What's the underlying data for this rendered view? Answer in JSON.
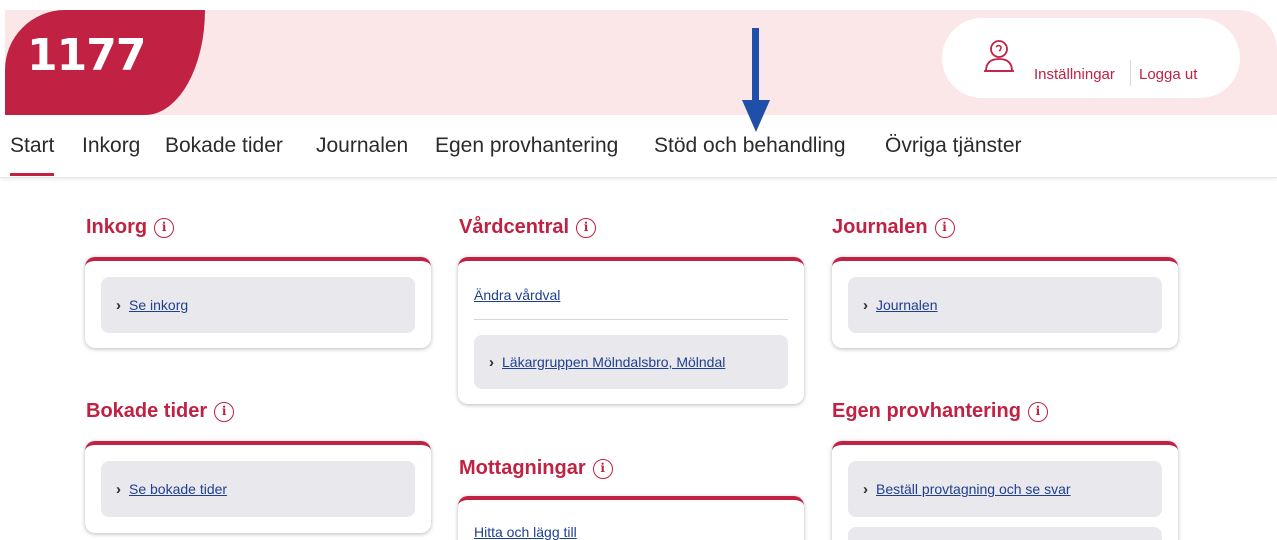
{
  "header": {
    "logo": "1177",
    "settings_label": "Inställningar",
    "logout_label": "Logga ut"
  },
  "nav": {
    "items": [
      "Start",
      "Inkorg",
      "Bokade tider",
      "Journalen",
      "Egen provhantering",
      "Stöd och behandling",
      "Övriga tjänster"
    ],
    "active": "Start"
  },
  "sections": {
    "inkorg": {
      "title": "Inkorg",
      "link": "Se inkorg"
    },
    "bokade": {
      "title": "Bokade tider",
      "link": "Se bokade tider"
    },
    "vardcentral": {
      "title": "Vårdcentral",
      "change_link": "Ändra vårdval",
      "clinic_link": "Läkargruppen Mölndalsbro, Mölndal"
    },
    "mottagningar": {
      "title": "Mottagningar",
      "link": "Hitta och lägg till"
    },
    "journalen": {
      "title": "Journalen",
      "link": "Journalen"
    },
    "egen": {
      "title": "Egen provhantering",
      "link": "Beställ provtagning och se svar"
    }
  },
  "info_icon_glyph": "i",
  "chevron_glyph": "›",
  "colors": {
    "brand": "#c12143",
    "header_bg": "#fbe6e8",
    "link": "#1f3f8f",
    "row_bg": "#e9e8ec",
    "arrow": "#1f4fa8"
  }
}
